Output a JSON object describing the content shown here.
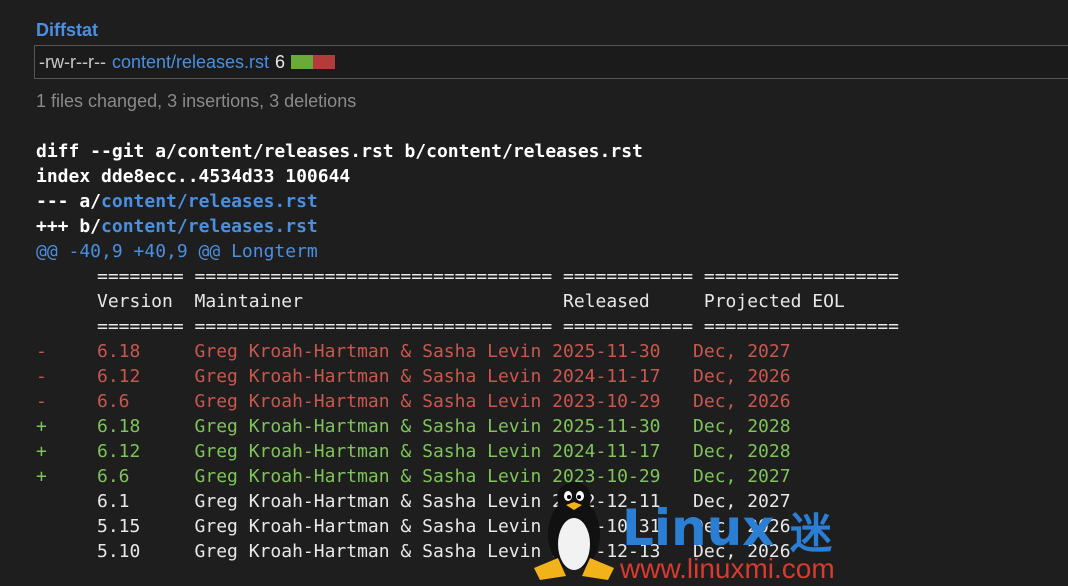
{
  "diffstat": {
    "title": "Diffstat",
    "mode": "-rw-r--r--",
    "file": "content/releases.rst",
    "count": "6",
    "summary": "1 files changed, 3 insertions, 3 deletions"
  },
  "diff": {
    "header1": "diff --git a/content/releases.rst b/content/releases.rst",
    "header2": "index dde8ecc..4534d33 100644",
    "minus_prefix": "--- a/",
    "plus_prefix": "+++ b/",
    "file": "content/releases.rst",
    "hunk": "@@ -40,9 +40,9 @@ Longterm",
    "lines": [
      {
        "type": "ctx",
        "marker": " ",
        "text": "======== ================================= ============ =================="
      },
      {
        "type": "ctx",
        "marker": " ",
        "text": "Version  Maintainer                        Released     Projected EOL"
      },
      {
        "type": "ctx",
        "marker": " ",
        "text": "======== ================================= ============ =================="
      },
      {
        "type": "del",
        "marker": "-",
        "text": "6.18     Greg Kroah-Hartman & Sasha Levin 2025-11-30   Dec, 2027"
      },
      {
        "type": "del",
        "marker": "-",
        "text": "6.12     Greg Kroah-Hartman & Sasha Levin 2024-11-17   Dec, 2026"
      },
      {
        "type": "del",
        "marker": "-",
        "text": "6.6      Greg Kroah-Hartman & Sasha Levin 2023-10-29   Dec, 2026"
      },
      {
        "type": "add",
        "marker": "+",
        "text": "6.18     Greg Kroah-Hartman & Sasha Levin 2025-11-30   Dec, 2028"
      },
      {
        "type": "add",
        "marker": "+",
        "text": "6.12     Greg Kroah-Hartman & Sasha Levin 2024-11-17   Dec, 2028"
      },
      {
        "type": "add",
        "marker": "+",
        "text": "6.6      Greg Kroah-Hartman & Sasha Levin 2023-10-29   Dec, 2027"
      },
      {
        "type": "ctx",
        "marker": " ",
        "text": "6.1      Greg Kroah-Hartman & Sasha Levin 2022-12-11   Dec, 2027"
      },
      {
        "type": "ctx",
        "marker": " ",
        "text": "5.15     Greg Kroah-Hartman & Sasha Levin 2021-10-31   Dec, 2026"
      },
      {
        "type": "ctx",
        "marker": " ",
        "text": "5.10     Greg Kroah-Hartman & Sasha Levin 2020-12-13   Dec, 2026"
      }
    ]
  },
  "watermark": {
    "brand": "Linux",
    "mi": "迷",
    "url": "www.linuxmi.com"
  },
  "colors": {
    "link": "#4a8fe0",
    "deleted": "#c8584e",
    "added": "#7ec45a",
    "background": "#1e1e1e"
  }
}
